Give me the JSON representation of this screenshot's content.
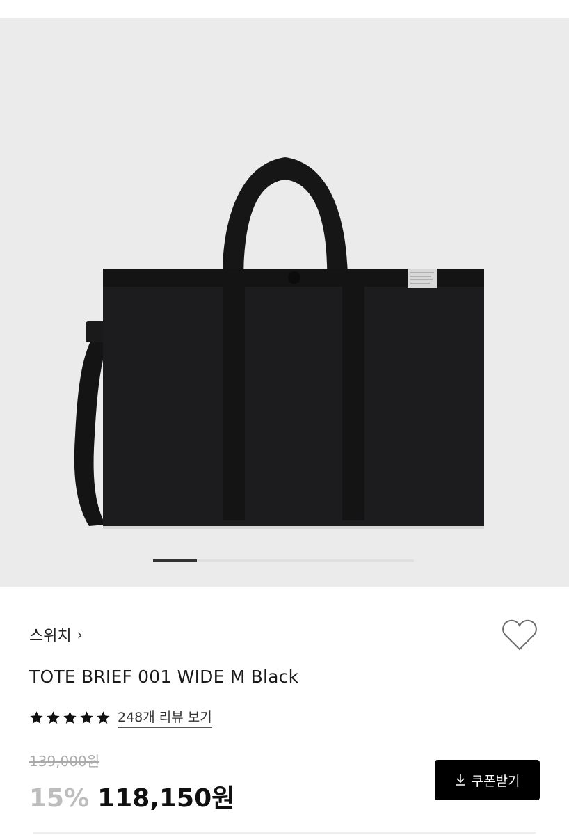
{
  "product": {
    "image_alt": "Black tote bag with shoulder strap",
    "carousel_position": "1",
    "brand": "스위치",
    "brand_chevron": "›",
    "title": "TOTE BRIEF 001 WIDE M Black",
    "rating_stars": 5,
    "review_link": "248개 리뷰 보기",
    "original_price": "139,000원",
    "discount": "15%",
    "final_price": "118,150원",
    "coupon_button": "쿠폰받기",
    "coupon_icon": "download-icon",
    "wishlist_icon": "heart-icon"
  },
  "colors": {
    "background": "#ebebeb",
    "bag": "#1c1c1e",
    "button_bg": "#000000",
    "discount": "#bdbdbd"
  }
}
